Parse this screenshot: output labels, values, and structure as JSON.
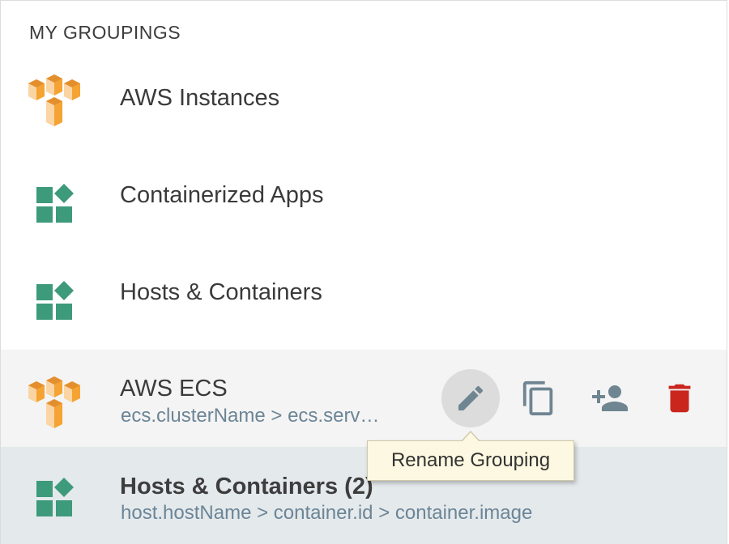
{
  "section_title": "MY GROUPINGS",
  "colors": {
    "aws_orange": "#f5a333",
    "container_green": "#3d9a7b",
    "action_gray": "#6f8592",
    "delete_red": "#c9261e",
    "tooltip_bg": "#fdf8e1"
  },
  "groupings": [
    {
      "name": "AWS Instances",
      "icon": "aws-cubes-icon",
      "subtitle": ""
    },
    {
      "name": "Containerized Apps",
      "icon": "container-blocks-icon",
      "subtitle": ""
    },
    {
      "name": "Hosts & Containers",
      "icon": "container-blocks-icon",
      "subtitle": ""
    },
    {
      "name": "AWS ECS",
      "icon": "aws-cubes-icon",
      "subtitle": "ecs.clusterName > ecs.serv…",
      "state": "hovered"
    },
    {
      "name": "Hosts & Containers (2)",
      "icon": "container-blocks-icon",
      "subtitle": "host.hostName > container.id > container.image",
      "state": "selected"
    }
  ],
  "row_actions": [
    {
      "icon": "pencil-icon",
      "label": "Rename Grouping"
    },
    {
      "icon": "copy-icon",
      "label": "Copy Grouping"
    },
    {
      "icon": "add-user-icon",
      "label": "Share Grouping"
    },
    {
      "icon": "trash-icon",
      "label": "Delete Grouping"
    }
  ],
  "tooltip": {
    "text": "Rename Grouping"
  }
}
